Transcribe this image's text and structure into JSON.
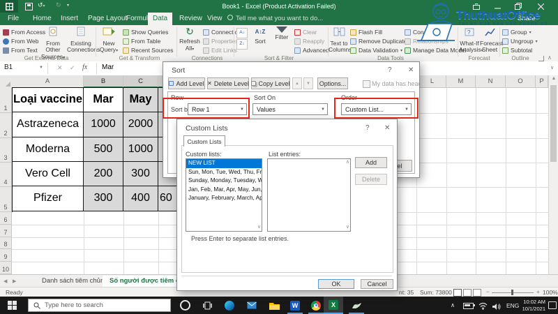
{
  "window": {
    "title": "Book1 - Excel (Product Activation Failed)"
  },
  "watermark": {
    "brand": "ThuthuatOffice",
    "tagline": "TRI KỶ CỦA DÂN VĂN PHÒNG SỐ"
  },
  "tabs": {
    "file": "File",
    "home": "Home",
    "insert": "Insert",
    "page_layout": "Page Layout",
    "formulas": "Formulas",
    "data": "Data",
    "review": "Review",
    "view": "View",
    "tell_me": "Tell me what you want to do...",
    "share": "Share"
  },
  "ribbon": {
    "g1": {
      "label": "Get External Data",
      "b1": "From Access",
      "b2": "From Web",
      "b3": "From Text",
      "b4": "From Other\nSources",
      "b5": "Existing\nConnections"
    },
    "g2": {
      "label": "Get & Transform",
      "b1": "New\nQuery",
      "b2": "Show Queries",
      "b3": "From Table",
      "b4": "Recent Sources"
    },
    "g3": {
      "label": "Connections",
      "b1": "Refresh\nAll",
      "b2": "Connections",
      "b3": "Properties",
      "b4": "Edit Links"
    },
    "g4": {
      "label": "Sort & Filter",
      "b1": "Sort",
      "b2": "Filter",
      "b3": "Clear",
      "b4": "Reapply",
      "b5": "Advanced"
    },
    "g5": {
      "label": "Data Tools",
      "b1": "Text to\nColumns",
      "b2": "Flash Fill",
      "b3": "Remove Duplicates",
      "b4": "Data Validation",
      "b5": "Consolidate",
      "b6": "Relationships",
      "b7": "Manage Data Model"
    },
    "g6": {
      "label": "Forecast",
      "b1": "What-If\nAnalysis",
      "b2": "Forecast\nSheet"
    },
    "g7": {
      "label": "Outline",
      "b1": "Group",
      "b2": "Ungroup",
      "b3": "Subtotal"
    }
  },
  "formula_bar": {
    "name_box": "B1",
    "value": "Mar"
  },
  "grid": {
    "cols_left": [
      "A",
      "B",
      "C"
    ],
    "cols_right": [
      "L",
      "M",
      "N",
      "O",
      "P"
    ],
    "rows": [
      "1",
      "2",
      "3",
      "4",
      "5",
      "6",
      "7",
      "8",
      "9",
      "10"
    ]
  },
  "table": {
    "header": [
      "Loại vaccine",
      "Mar",
      "May"
    ],
    "rows": [
      [
        "Astrazeneca",
        "1000",
        "2000"
      ],
      [
        "Moderna",
        "500",
        "1000"
      ],
      [
        "Vero Cell",
        "200",
        "300"
      ],
      [
        "Pfizer",
        "300",
        "400"
      ]
    ],
    "d_fragment": "60"
  },
  "sort_dialog": {
    "title": "Sort",
    "add_level": "Add Level",
    "delete_level": "Delete Level",
    "copy_level": "Copy Level",
    "options": "Options...",
    "my_data": "My data has headers",
    "col_row": "Row",
    "col_sort_on": "Sort On",
    "col_order": "Order",
    "sort_by": "Sort by",
    "sort_by_value": "Row 1",
    "sort_on_value": "Values",
    "order_value": "Custom List...",
    "cancel": "Cancel"
  },
  "custom_lists": {
    "title": "Custom Lists",
    "tab": "Custom Lists",
    "lists_label": "Custom lists:",
    "entries_label": "List entries:",
    "items": [
      "NEW LIST",
      "Sun, Mon, Tue, Wed, Thu, Fri, Sat",
      "Sunday, Monday, Tuesday, Wedne",
      "Jan, Feb, Mar, Apr, May, Jun, Jul, A",
      "January, February, March, April, M"
    ],
    "add": "Add",
    "delete": "Delete",
    "hint": "Press Enter to separate list entries.",
    "ok": "OK",
    "cancel": "Cancel"
  },
  "sheet_tabs": {
    "tab1": "Danh sách tiêm chủng",
    "tab2": "Số người được tiêm chún"
  },
  "status": {
    "ready": "Ready",
    "count_fragment": "nt: 35",
    "sum": "Sum: 73800",
    "zoom": "100%"
  },
  "taskbar": {
    "search": "Type here to search",
    "lang": "ENG",
    "time": "10:02 AM",
    "date": "10/1/2021"
  },
  "colors": {
    "excel_green": "#217346",
    "selection_blue": "#0078d7",
    "annotation_red": "#e02718",
    "brand_blue": "#1565c0"
  }
}
